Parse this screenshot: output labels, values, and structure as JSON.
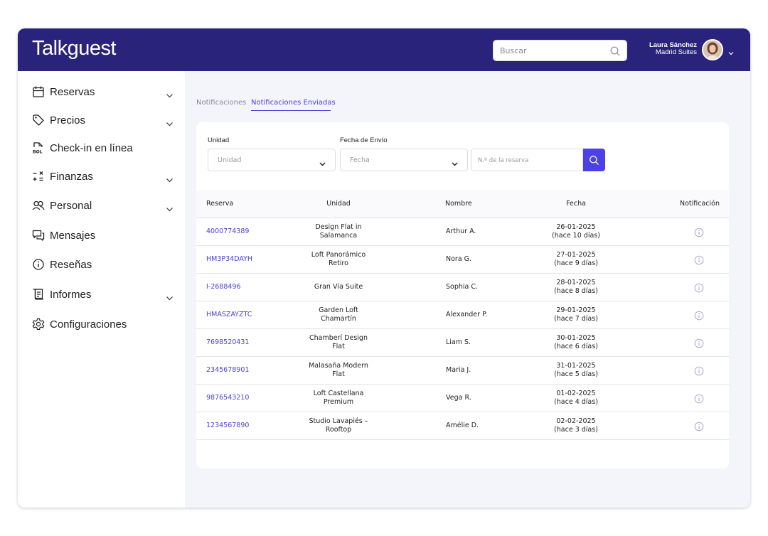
{
  "header": {
    "logo": "Talkguest",
    "search_placeholder": "Buscar",
    "user": {
      "name": "Laura Sánchez",
      "property": "Madrid Suites"
    }
  },
  "sidebar": {
    "items": [
      {
        "label": "Reservas",
        "icon": "calendar-icon",
        "expandable": true
      },
      {
        "label": "Precios",
        "icon": "tag-icon",
        "expandable": true
      },
      {
        "label": "Check-in en línea",
        "icon": "bol-document-icon",
        "expandable": false
      },
      {
        "label": "Finanzas",
        "icon": "calculator-icon",
        "expandable": true
      },
      {
        "label": "Personal",
        "icon": "users-icon",
        "expandable": true
      },
      {
        "label": "Mensajes",
        "icon": "chat-icon",
        "expandable": false
      },
      {
        "label": "Reseñas",
        "icon": "info-icon",
        "expandable": false
      },
      {
        "label": "Informes",
        "icon": "report-icon",
        "expandable": true
      },
      {
        "label": "Configuraciones",
        "icon": "gear-icon",
        "expandable": false
      }
    ]
  },
  "tabs": [
    {
      "label": "Notificaciones",
      "active": false
    },
    {
      "label": "Notificaciones Enviadas",
      "active": true
    }
  ],
  "filters": {
    "unidad_label": "Unidad",
    "unidad_value": "Unidad",
    "fecha_label": "Fecha de Envío",
    "fecha_value": "Fecha",
    "reserva_placeholder": "N.º de la reserva"
  },
  "table": {
    "headers": [
      "Reserva",
      "Unidad",
      "Nombre",
      "Fecha",
      "Notificación"
    ],
    "rows": [
      {
        "reserva": "4000774389",
        "unidad": [
          "Design Flat in",
          "Salamanca"
        ],
        "nombre": "Arthur A.",
        "fecha": [
          "26-01-2025",
          "(hace 10 días)"
        ]
      },
      {
        "reserva": "HM3P34DAYH",
        "unidad": [
          "Loft Panorámico",
          "Retiro"
        ],
        "nombre": "Nora G.",
        "fecha": [
          "27-01-2025",
          "(hace 9 días)"
        ]
      },
      {
        "reserva": "I-2688496",
        "unidad": [
          "Gran Vía Suite"
        ],
        "nombre": "Sophia C.",
        "fecha": [
          "28-01-2025",
          "(hace 8 días)"
        ]
      },
      {
        "reserva": "HMASZAYZTC",
        "unidad": [
          "Garden Loft",
          "Chamartín"
        ],
        "nombre": "Alexander P.",
        "fecha": [
          "29-01-2025",
          "(hace 7 días)"
        ]
      },
      {
        "reserva": "7698520431",
        "unidad": [
          "Chamberí Design",
          "Flat"
        ],
        "nombre": "Liam S.",
        "fecha": [
          "30-01-2025",
          "(hace 6 días)"
        ]
      },
      {
        "reserva": "2345678901",
        "unidad": [
          "Malasaña Modern",
          "Flat"
        ],
        "nombre": "Maria J.",
        "fecha": [
          "31-01-2025",
          "(hace 5 días)"
        ]
      },
      {
        "reserva": "9876543210",
        "unidad": [
          "Loft Castellana",
          "Premium"
        ],
        "nombre": "Vega R.",
        "fecha": [
          "01-02-2025",
          "(hace 4 días)"
        ]
      },
      {
        "reserva": "1234567890",
        "unidad": [
          "Studio Lavapiés –",
          "Rooftop"
        ],
        "nombre": "Amélie D.",
        "fecha": [
          "02-02-2025",
          "(hace 3 días)"
        ]
      }
    ]
  },
  "colors": {
    "header_bg": "#29237b",
    "accent": "#4b41d9",
    "page_bg": "#f4f4fb"
  }
}
